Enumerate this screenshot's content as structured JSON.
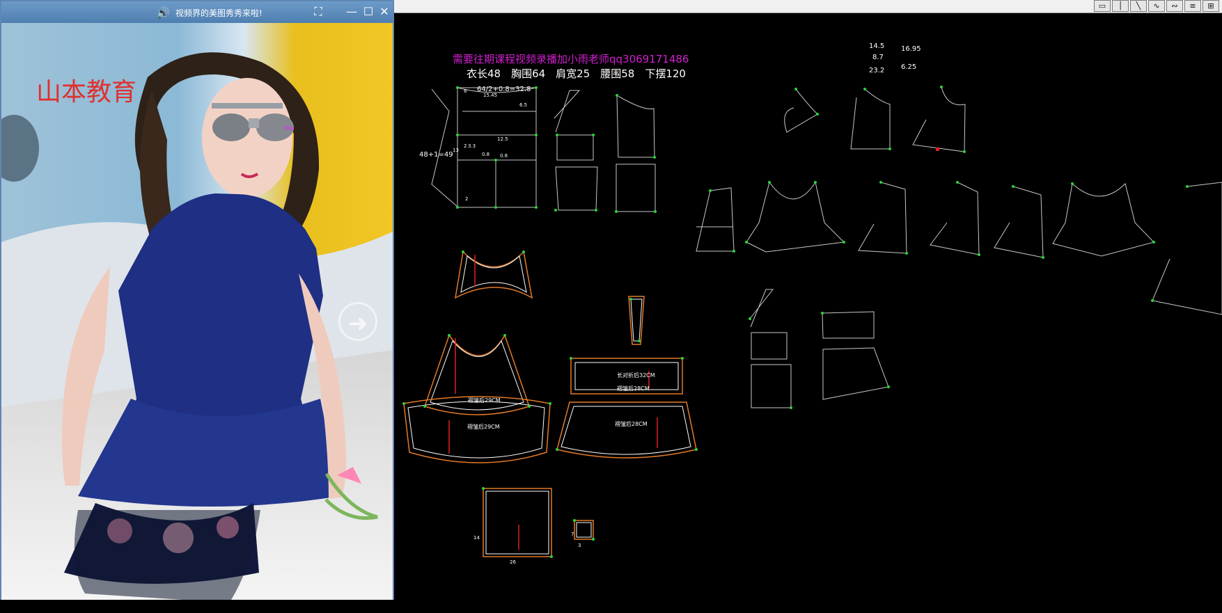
{
  "popup": {
    "title": "视频界的美图秀秀来啦!",
    "watermark": "山本教育",
    "speaker_icon": "speaker-icon",
    "buttons": {
      "capture": "⛶",
      "minimize": "—",
      "maximize": "☐",
      "close": "✕"
    }
  },
  "cad": {
    "header_note": "需要往期课程视频录播加小雨老师qq3069171486",
    "measurements": "衣长48　胸围64　肩宽25　腰围58　下摆120",
    "calc_note": "64/2+0.8=32.8",
    "side_note": "48+1=49",
    "numbers": [
      "14.5",
      "16.95",
      "8.7",
      "23.2",
      "6.25"
    ],
    "small_labels": [
      "6",
      "6.5",
      "13",
      "15.45",
      "2",
      "3.3",
      "12.5",
      "0.8",
      "0.8",
      "2",
      "26",
      "14",
      "7",
      "3"
    ],
    "pleat_labels": [
      "褶皱后29CM",
      "褶皱后29CM",
      "长对折后32CM",
      "褶皱后28CM",
      "褶皱后28CM"
    ],
    "colors": {
      "note": "#d11fd0",
      "text": "#ffffff",
      "line": "#c8c8c8",
      "point": "#2bd43a",
      "seam": "#e47a27",
      "accent": "#e02020"
    }
  },
  "toolbar": {
    "icons": [
      "rect-tool-icon",
      "line-tool-icon",
      "diagonal-tool-icon",
      "curve-tool-icon",
      "curve-alt-tool-icon",
      "grid-tool-icon",
      "ruler-tool-icon"
    ]
  }
}
